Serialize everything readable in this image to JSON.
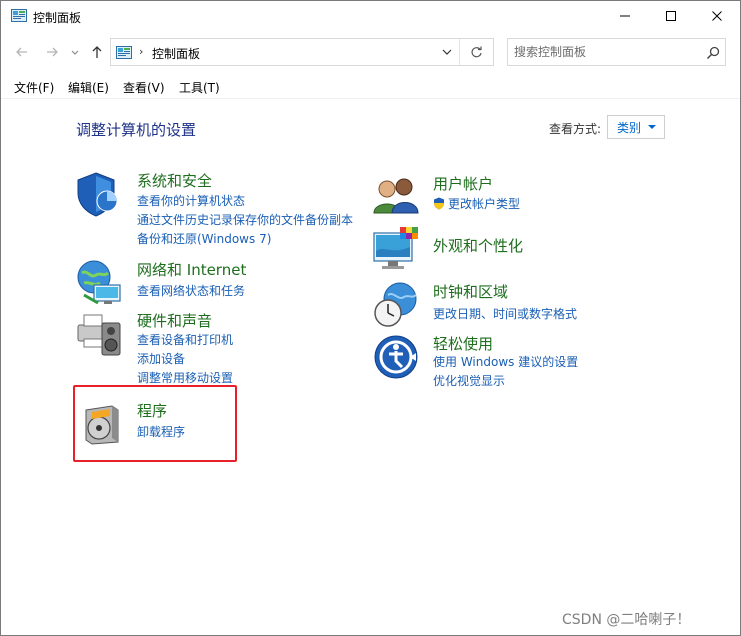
{
  "window": {
    "title": "控制面板"
  },
  "navigation": {
    "breadcrumb_separator": "›",
    "address": "控制面板",
    "search_placeholder": "搜索控制面板"
  },
  "menu": {
    "items": [
      {
        "label": "文件(F)"
      },
      {
        "label": "编辑(E)"
      },
      {
        "label": "查看(V)"
      },
      {
        "label": "工具(T)"
      }
    ]
  },
  "content": {
    "page_title": "调整计算机的设置",
    "view_by_label": "查看方式:",
    "view_by_value": "类别",
    "categories": [
      {
        "title": "系统和安全",
        "icon": "shield-icon",
        "links": [
          "查看你的计算机状态",
          "通过文件历史记录保存你的文件备份副本",
          "备份和还原(Windows 7)"
        ]
      },
      {
        "title": "网络和 Internet",
        "icon": "network-globe-icon",
        "links": [
          "查看网络状态和任务"
        ]
      },
      {
        "title": "硬件和声音",
        "icon": "printer-speaker-icon",
        "links": [
          "查看设备和打印机",
          "添加设备",
          "调整常用移动设置"
        ]
      },
      {
        "title": "程序",
        "icon": "programs-disc-icon",
        "links": [
          "卸载程序"
        ]
      },
      {
        "title": "用户帐户",
        "icon": "users-icon",
        "links": [
          "更改帐户类型"
        ]
      },
      {
        "title": "外观和个性化",
        "icon": "monitor-palette-icon",
        "links": []
      },
      {
        "title": "时钟和区域",
        "icon": "clock-globe-icon",
        "links": [
          "更改日期、时间或数字格式"
        ]
      },
      {
        "title": "轻松使用",
        "icon": "ease-of-access-icon",
        "links": [
          "使用 Windows 建议的设置",
          "优化视觉显示"
        ]
      }
    ]
  },
  "watermark": "CSDN @二哈喇子！",
  "colors": {
    "category_title": "#1e6e1e",
    "link": "#1a5fb4",
    "page_title": "#1e3287",
    "highlight_border": "#e8202a"
  }
}
